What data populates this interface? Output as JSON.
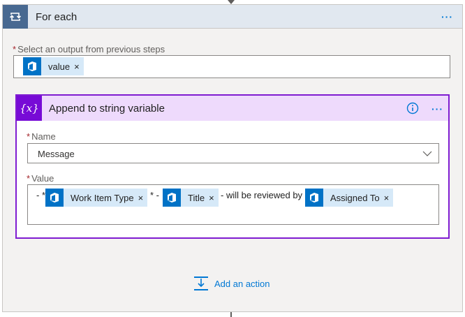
{
  "foreach": {
    "title": "For each",
    "menu_label": "···",
    "output_label_req": "*",
    "output_label": "Select an output from previous steps",
    "output_token": {
      "label": "value",
      "remove": "×"
    }
  },
  "action": {
    "title": "Append to string variable",
    "menu_label": "···",
    "icon_text": "{x}",
    "name_label_req": "*",
    "name_label": "Name",
    "name_value": "Message",
    "value_label_req": "*",
    "value_label": "Value",
    "value_parts": {
      "prefix": "- *",
      "token1": "Work Item Type",
      "sep1": "* -",
      "token2": "Title",
      "sep2": "- will be reviewed by",
      "token3": "Assigned To",
      "remove": "×"
    }
  },
  "add_action_label": "Add an action",
  "icons": {
    "foreach": "loop-icon",
    "variable": "variable-icon",
    "devops": "azure-devops-icon",
    "info": "info-icon",
    "chevron": "chevron-down-icon",
    "add_action": "add-action-icon"
  },
  "colors": {
    "foreach_accent": "#486991",
    "variable_accent": "#770bd6",
    "link": "#0078d4",
    "token_bg": "#d6e9f8",
    "devops_icon_bg": "#0072c6"
  }
}
